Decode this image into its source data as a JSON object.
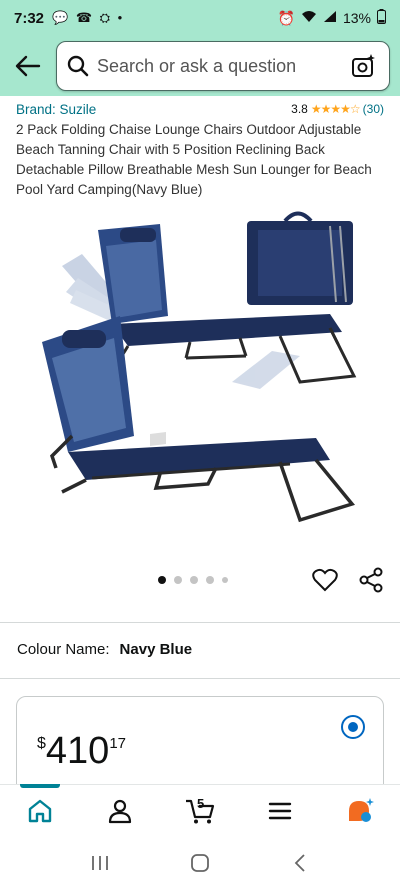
{
  "status_bar": {
    "time": "7:32",
    "notifications": "💬 ☎ ⛭ •",
    "battery": "13%"
  },
  "search": {
    "placeholder": "Search or ask a question"
  },
  "product": {
    "brand": "Brand: Suzile",
    "rating": "3.8",
    "stars": "★★★★☆",
    "review_count": "(30)",
    "title": "2 Pack Folding Chaise Lounge Chairs Outdoor Adjustable Beach Tanning Chair with 5 Position Reclining Back Detachable Pillow Breathable Mesh Sun Lounger for Beach Pool Yard Camping(Navy Blue)"
  },
  "carousel": {
    "total": 5,
    "active_index": 0
  },
  "colour": {
    "label": "Colour Name:",
    "value": "Navy Blue"
  },
  "price": {
    "symbol": "$",
    "whole": "410",
    "fraction": "17"
  },
  "bottom_nav": {
    "items": [
      "home-icon",
      "account-icon",
      "cart-icon",
      "menu-icon",
      "rufus-icon"
    ],
    "cart_count": "5",
    "accent": "#008296"
  },
  "colors": {
    "header_bg": "#a6e7ce",
    "link": "#007185",
    "star": "#ffa41c",
    "chair_navy": "#1e2f5a"
  }
}
